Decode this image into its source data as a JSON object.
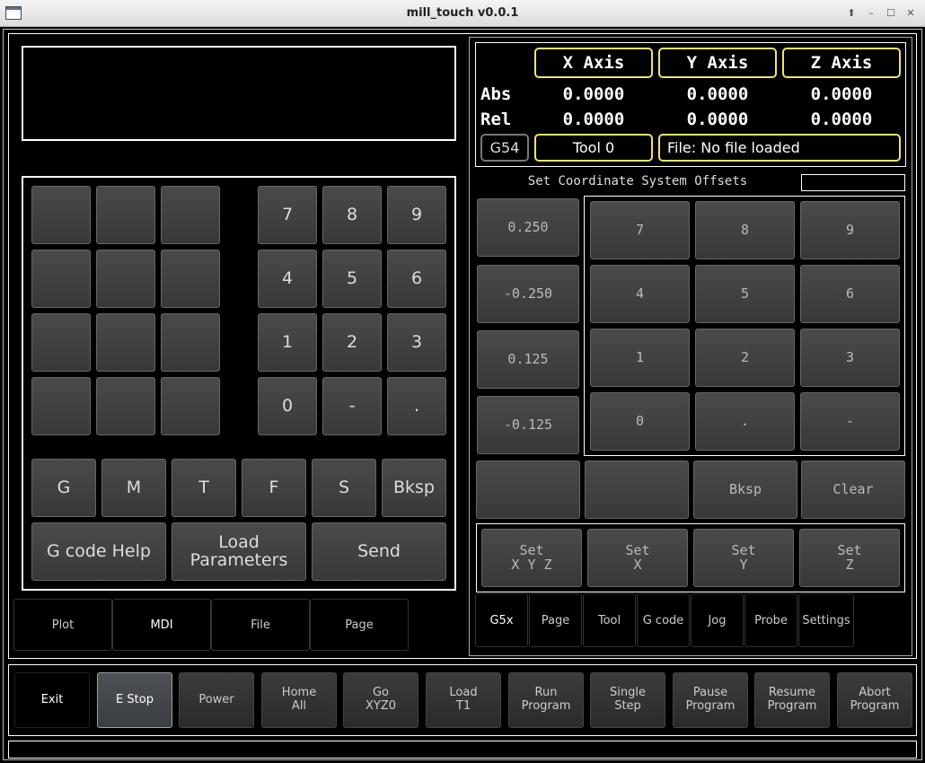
{
  "window": {
    "title": "mill_touch v0.0.1"
  },
  "mdi": {
    "display_text": "",
    "numpad": [
      "7",
      "8",
      "9",
      "4",
      "5",
      "6",
      "1",
      "2",
      "3",
      "0",
      "-",
      "."
    ],
    "letter_keys": [
      "G",
      "M",
      "T",
      "F",
      "S",
      "Bksp"
    ],
    "action_keys": [
      "G code Help",
      "Load\nParameters",
      "Send"
    ]
  },
  "left_tabs": [
    {
      "label": "Plot",
      "selected": false
    },
    {
      "label": "MDI",
      "selected": true
    },
    {
      "label": "File",
      "selected": false
    },
    {
      "label": "Page",
      "selected": false
    }
  ],
  "dro": {
    "axes": [
      "X Axis",
      "Y Axis",
      "Z Axis"
    ],
    "rows": [
      {
        "label": "Abs",
        "values": [
          "0.0000",
          "0.0000",
          "0.0000"
        ]
      },
      {
        "label": "Rel",
        "values": [
          "0.0000",
          "0.0000",
          "0.0000"
        ]
      }
    ],
    "coord_system": "G54",
    "tool": "Tool 0",
    "file": "File: No file loaded"
  },
  "offsets": {
    "title": "Set Coordinate System Offsets",
    "entry_value": "",
    "increments": [
      "0.250",
      "-0.250",
      "0.125",
      "-0.125"
    ],
    "numpad": [
      "7",
      "8",
      "9",
      "4",
      "5",
      "6",
      "1",
      "2",
      "3",
      "0",
      ".",
      "-"
    ],
    "bottom_keys": [
      "",
      "",
      "Bksp",
      "Clear"
    ],
    "set_keys": [
      "Set\nX Y Z",
      "Set\nX",
      "Set\nY",
      "Set\nZ"
    ]
  },
  "right_tabs": [
    {
      "label": "G5x",
      "selected": true
    },
    {
      "label": "Page",
      "selected": false
    },
    {
      "label": "Tool",
      "selected": false
    },
    {
      "label": "G code",
      "selected": false
    },
    {
      "label": "Jog",
      "selected": false
    },
    {
      "label": "Probe",
      "selected": false
    },
    {
      "label": "Settings",
      "selected": false
    }
  ],
  "controls": [
    {
      "label": "Exit",
      "style": "black"
    },
    {
      "label": "E Stop",
      "style": "active"
    },
    {
      "label": "Power",
      "style": "normal"
    },
    {
      "label": "Home\nAll",
      "style": "normal"
    },
    {
      "label": "Go\nXYZ0",
      "style": "normal"
    },
    {
      "label": "Load\nT1",
      "style": "normal"
    },
    {
      "label": "Run\nProgram",
      "style": "normal"
    },
    {
      "label": "Single\nStep",
      "style": "normal"
    },
    {
      "label": "Pause\nProgram",
      "style": "normal"
    },
    {
      "label": "Resume\nProgram",
      "style": "normal"
    },
    {
      "label": "Abort\nProgram",
      "style": "normal"
    }
  ],
  "status_bar": {
    "text": ""
  },
  "colors": {
    "accent_yellow": "#f0e46a",
    "background": "#000000"
  },
  "icons": {
    "app": "window-icon",
    "title_buttons": [
      "up-arrow-icon",
      "minimize-icon",
      "maximize-icon",
      "close-icon"
    ]
  }
}
